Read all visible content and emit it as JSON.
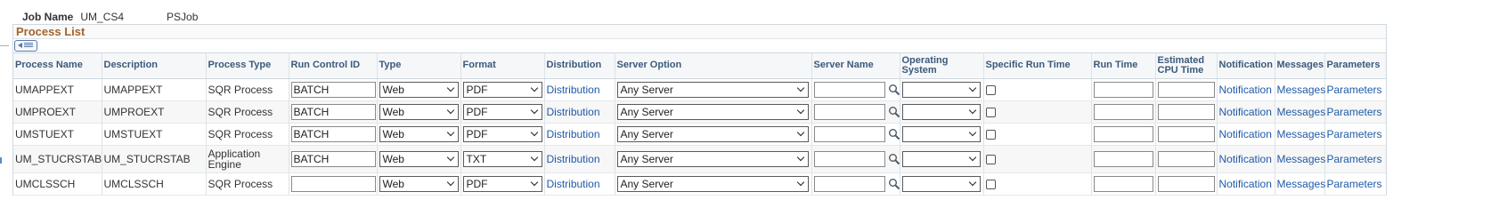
{
  "header": {
    "job_name_label": "Job Name",
    "job_name_value": "UM_CS4",
    "job_type": "PSJob"
  },
  "grid": {
    "title": "Process List",
    "columns": {
      "process_name": "Process Name",
      "description": "Description",
      "process_type": "Process Type",
      "run_control_id": "Run Control ID",
      "type": "Type",
      "format": "Format",
      "distribution": "Distribution",
      "server_option": "Server Option",
      "server_name": "Server Name",
      "operating_system": "Operating System",
      "specific_run_time": "Specific Run Time",
      "run_time": "Run Time",
      "estimated_cpu_time": "Estimated CPU Time",
      "notification": "Notification",
      "messages": "Messages",
      "parameters": "Parameters"
    },
    "rows": [
      {
        "process_name": "UMAPPEXT",
        "description": "UMAPPEXT",
        "process_type": "SQR Process",
        "run_control_id": "BATCH",
        "type": "Web",
        "format": "PDF",
        "distribution": "Distribution",
        "server_option": "Any Server",
        "server_name": "",
        "operating_system": "",
        "specific_run_time": false,
        "run_time": "",
        "estimated_cpu_time": "",
        "notification": "Notification",
        "messages": "Messages",
        "parameters": "Parameters"
      },
      {
        "process_name": "UMPROEXT",
        "description": "UMPROEXT",
        "process_type": "SQR Process",
        "run_control_id": "BATCH",
        "type": "Web",
        "format": "PDF",
        "distribution": "Distribution",
        "server_option": "Any Server",
        "server_name": "",
        "operating_system": "",
        "specific_run_time": false,
        "run_time": "",
        "estimated_cpu_time": "",
        "notification": "Notification",
        "messages": "Messages",
        "parameters": "Parameters"
      },
      {
        "process_name": "UMSTUEXT",
        "description": "UMSTUEXT",
        "process_type": "SQR Process",
        "run_control_id": "BATCH",
        "type": "Web",
        "format": "PDF",
        "distribution": "Distribution",
        "server_option": "Any Server",
        "server_name": "",
        "operating_system": "",
        "specific_run_time": false,
        "run_time": "",
        "estimated_cpu_time": "",
        "notification": "Notification",
        "messages": "Messages",
        "parameters": "Parameters"
      },
      {
        "process_name": "UM_STUCRSTAB",
        "description": "UM_STUCRSTAB",
        "process_type": "Application Engine",
        "run_control_id": "BATCH",
        "type": "Web",
        "format": "TXT",
        "distribution": "Distribution",
        "server_option": "Any Server",
        "server_name": "",
        "operating_system": "",
        "specific_run_time": false,
        "run_time": "",
        "estimated_cpu_time": "",
        "notification": "Notification",
        "messages": "Messages",
        "parameters": "Parameters"
      },
      {
        "process_name": "UMCLSSCH",
        "description": "UMCLSSCH",
        "process_type": "SQR Process",
        "run_control_id": "",
        "type": "Web",
        "format": "PDF",
        "distribution": "Distribution",
        "server_option": "Any Server",
        "server_name": "",
        "operating_system": "",
        "specific_run_time": false,
        "run_time": "",
        "estimated_cpu_time": "",
        "notification": "Notification",
        "messages": "Messages",
        "parameters": "Parameters"
      }
    ]
  },
  "icons": {
    "grid_nav": "grid-view-toggle-icon",
    "lookup": "magnifier-lookup-icon",
    "dropdown": "chevron-down-icon"
  },
  "colors": {
    "section_title": "#a5632a",
    "link": "#1f5aa8",
    "header_text": "#3c5a7a"
  }
}
